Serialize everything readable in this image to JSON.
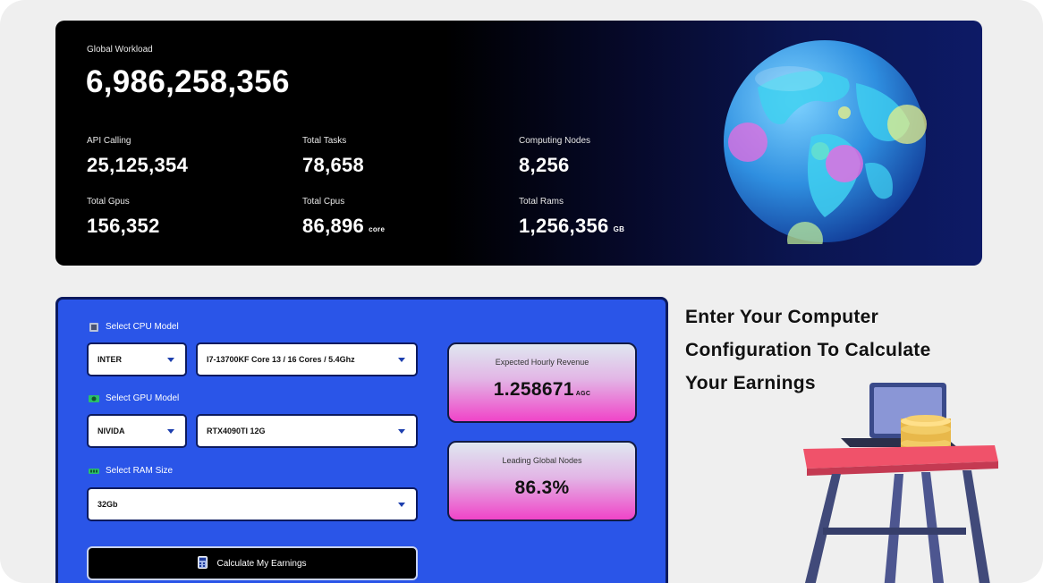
{
  "stats": {
    "global_workload_label": "Global Workload",
    "global_workload_value": "6,986,258,356",
    "api_calling_label": "API Calling",
    "api_calling_value": "25,125,354",
    "total_tasks_label": "Total Tasks",
    "total_tasks_value": "78,658",
    "computing_nodes_label": "Computing Nodes",
    "computing_nodes_value": "8,256",
    "total_gpus_label": "Total Gpus",
    "total_gpus_value": "156,352",
    "total_cpus_label": "Total Cpus",
    "total_cpus_value": "86,896",
    "total_cpus_unit": "core",
    "total_rams_label": "Total Rams",
    "total_rams_value": "1,256,356",
    "total_rams_unit": "GB"
  },
  "calculator": {
    "cpu_label": "Select CPU Model",
    "cpu_brand": "INTER",
    "cpu_model": "I7-13700KF Core 13 / 16 Cores / 5.4Ghz",
    "gpu_label": "Select GPU Model",
    "gpu_brand": "NIVIDA",
    "gpu_model": "RTX4090TI 12G",
    "ram_label": "Select RAM Size",
    "ram_size": "32Gb",
    "button_label": "Calculate My Earnings",
    "revenue_title": "Expected Hourly Revenue",
    "revenue_value": "1.258671",
    "revenue_unit": "AGC",
    "nodes_title": "Leading Global Nodes",
    "nodes_value": "86.3%"
  },
  "heading": {
    "line1": "Enter Your Computer",
    "line2": "Configuration To Calculate",
    "line3": "Your Earnings"
  },
  "colors": {
    "panel_blue": "#2a55e8",
    "card_gradient_end": "#f044c8",
    "globe_blue": "#2f8fe0"
  },
  "icons": [
    "cpu-icon",
    "gpu-icon",
    "ram-icon",
    "calculator-icon",
    "caret-down-icon",
    "globe-icon",
    "laptop-icon",
    "coins-icon"
  ]
}
